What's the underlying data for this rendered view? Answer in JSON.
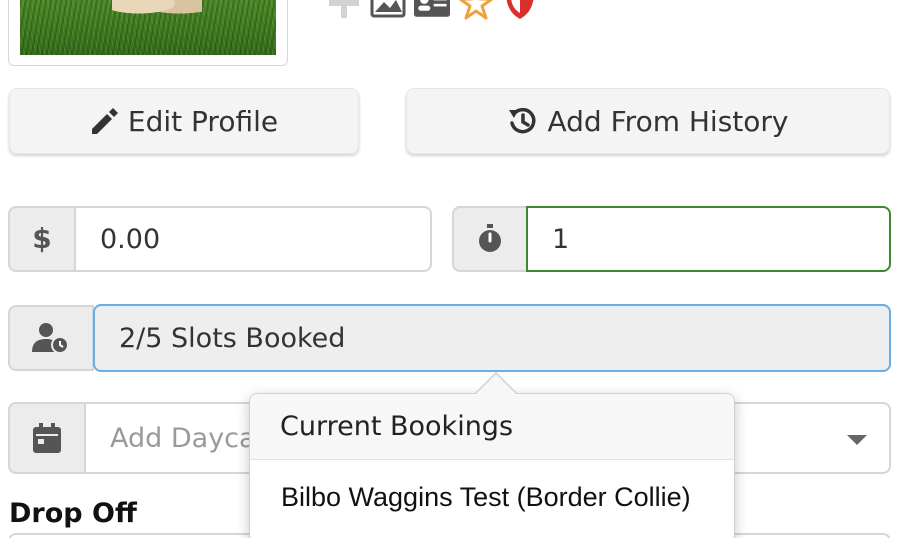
{
  "profile": {
    "edit_label": "Edit Profile",
    "history_label": "Add From History"
  },
  "fields": {
    "price_value": "0.00",
    "price_icon": "dollar-icon",
    "duration_value": "1",
    "duration_icon": "stopwatch-icon",
    "slots_value": "2/5 Slots Booked",
    "slots_icon": "user-clock-icon",
    "daycare_placeholder": "Add Daycare",
    "daycare_icon": "calendar-icon"
  },
  "popover": {
    "title": "Current Bookings",
    "items": [
      "Bilbo Waggins Test (Border Collie)"
    ]
  },
  "sections": {
    "dropoff_label": "Drop Off"
  },
  "colors": {
    "active_border": "#3a8a2a",
    "focus_border": "#67aee6",
    "star": "#f0a23a",
    "shield": "#d9302b"
  }
}
